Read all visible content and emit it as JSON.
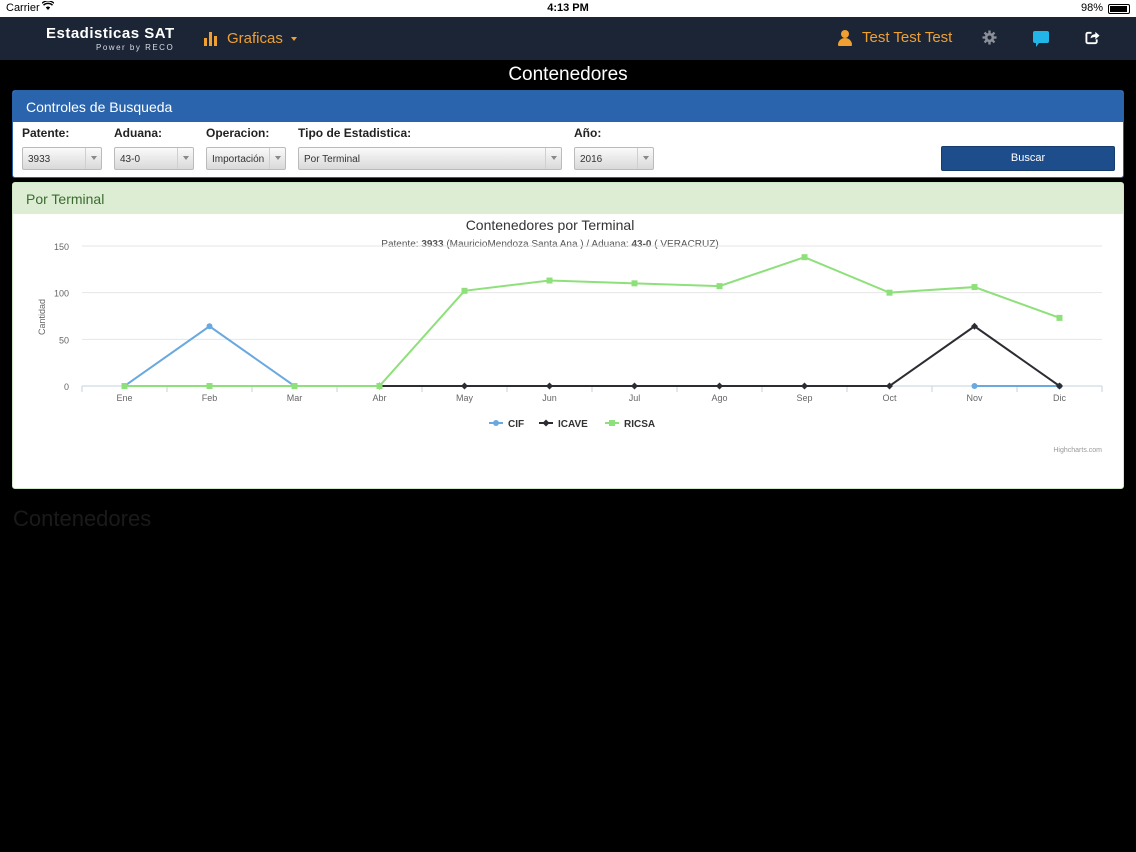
{
  "statusbar": {
    "carrier": "Carrier",
    "time": "4:13 PM",
    "battery": "98%"
  },
  "navbar": {
    "brand": "Estadisticas SAT",
    "brand_sub": "Power by RECO",
    "menu_label": "Graficas",
    "user_name": "Test Test Test"
  },
  "page_title": "Contenedores",
  "search_panel": {
    "title": "Controles de Busqueda",
    "fields": {
      "patente": {
        "label": "Patente:",
        "value": "3933"
      },
      "aduana": {
        "label": "Aduana:",
        "value": "43-0"
      },
      "operacion": {
        "label": "Operacion:",
        "value": "Importación"
      },
      "tipo": {
        "label": "Tipo de Estadistica:",
        "value": "Por Terminal"
      },
      "anio": {
        "label": "Año:",
        "value": "2016"
      }
    },
    "button": "Buscar"
  },
  "chart_panel": {
    "title": "Por Terminal"
  },
  "chart_data": {
    "type": "line",
    "title": "Contenedores por Terminal",
    "subtitle_parts": [
      "Patente: ",
      "3933",
      " (MauricioMendoza Santa Ana ) / Aduana: ",
      "43-0",
      " ( VERACRUZ)"
    ],
    "ylabel": "Cantidad",
    "ylim": [
      0,
      150
    ],
    "yticks": [
      0,
      50,
      100,
      150
    ],
    "grid": true,
    "legend_position": "bottom-center",
    "credits": "Highcharts.com",
    "categories": [
      "Ene",
      "Feb",
      "Mar",
      "Abr",
      "May",
      "Jun",
      "Jul",
      "Ago",
      "Sep",
      "Oct",
      "Nov",
      "Dic"
    ],
    "series": [
      {
        "name": "CIF",
        "color": "#6aa9e0",
        "marker": "circle",
        "values": [
          0,
          64,
          0,
          0,
          null,
          null,
          null,
          null,
          null,
          null,
          0,
          0
        ]
      },
      {
        "name": "ICAVE",
        "color": "#2b2d33",
        "marker": "diamond",
        "values": [
          null,
          null,
          null,
          0,
          0,
          0,
          0,
          0,
          0,
          0,
          64,
          0
        ]
      },
      {
        "name": "RICSA",
        "color": "#8ee07a",
        "marker": "square",
        "values": [
          0,
          0,
          0,
          0,
          102,
          113,
          110,
          107,
          138,
          100,
          106,
          73
        ]
      }
    ]
  },
  "footer_title": "Contenedores"
}
